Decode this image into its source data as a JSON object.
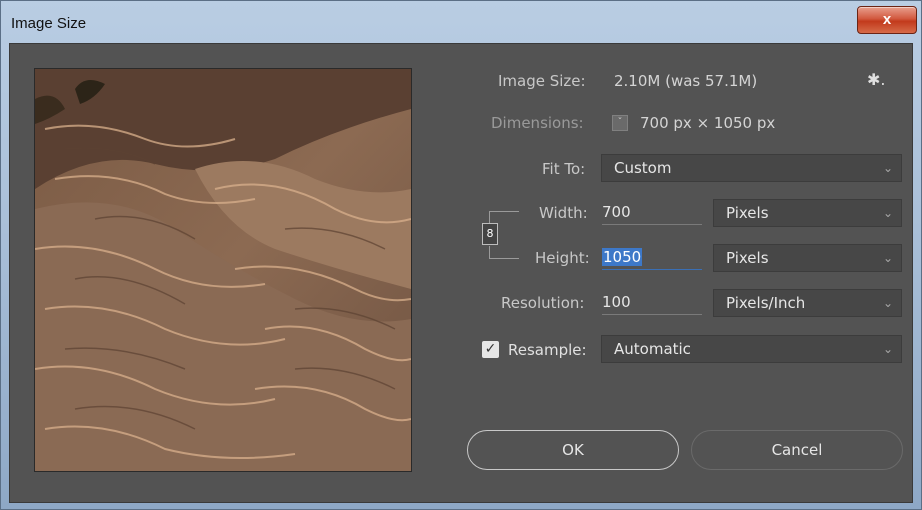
{
  "window": {
    "title": "Image Size",
    "close_label": "x"
  },
  "info": {
    "image_size_label": "Image Size:",
    "image_size_value": "2.10M (was 57.1M)",
    "dimensions_label": "Dimensions:",
    "dimensions_value": "700 px × 1050 px",
    "gear_icon": "✱.",
    "dim_toggle_icon": "ˇ"
  },
  "fit_to": {
    "label": "Fit To:",
    "value": "Custom"
  },
  "width": {
    "label": "Width:",
    "value": "700",
    "unit": "Pixels"
  },
  "height": {
    "label": "Height:",
    "value": "1050",
    "unit": "Pixels"
  },
  "resolution": {
    "label": "Resolution:",
    "value": "100",
    "unit": "Pixels/Inch"
  },
  "resample": {
    "checked": true,
    "label": "Resample:",
    "value": "Automatic"
  },
  "chain_icon": "8",
  "chevron": "⌄",
  "buttons": {
    "ok": "OK",
    "cancel": "Cancel"
  },
  "colors": {
    "dialog_bg": "#535353",
    "field_bg": "#474747",
    "selection": "#3d78c8",
    "close_red": "#c23a1c"
  }
}
